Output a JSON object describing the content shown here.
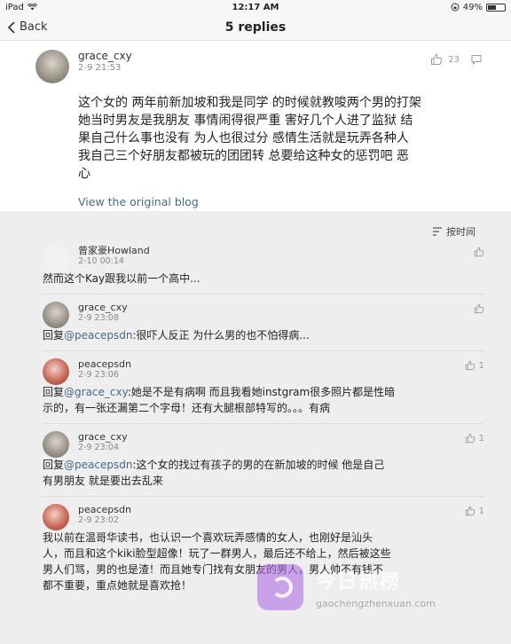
{
  "status": {
    "device": "iPad",
    "time": "12:17 AM",
    "battery": "49%",
    "battery_level": 0.49
  },
  "nav": {
    "back_label": "Back",
    "title": "5 replies"
  },
  "post": {
    "username": "grace_cxy",
    "date": "2-9 21:53",
    "likes": "23",
    "lines": [
      "这个女的 两年前新加坡和我是同学 的时候就教唆两个男的打架",
      "她当时男友是我朋友  事情闹得很严重 害好几个人进了监狱 结",
      "果自己什么事也没有  为人也很过分 感情生活就是玩弄各种人",
      "我自己三个好朋友都被玩的团团转 总要给这种女的惩罚吧  恶",
      "心"
    ],
    "view_original": "View the original blog"
  },
  "sort": {
    "label": "按时间"
  },
  "replies": [
    {
      "name": "曾家豪Howland",
      "date": "2-10 00:14",
      "likes": "",
      "line1_prefix": "然而这个Kay跟我以前一个高中...",
      "line1_mention": "",
      "line1_suffix": "",
      "line2": ""
    },
    {
      "name": "grace_cxy",
      "date": "2-9 23:08",
      "likes": "",
      "line1_prefix": "回复",
      "line1_mention": "@peacepsdn",
      "line1_suffix": ":很吓人反正 为什么男的也不怕得病...",
      "line2": ""
    },
    {
      "name": "peacepsdn",
      "date": "2-9 23:06",
      "likes": "1",
      "line1_prefix": "回复",
      "line1_mention": "@grace_cxy",
      "line1_suffix": ":她是不是有病啊 而且我看她instgram很多照片都是性暗",
      "line2": "示的，有一张还漏第二个字母！还有大腿根部特写的。。。有病"
    },
    {
      "name": "grace_cxy",
      "date": "2-9 23:04",
      "likes": "1",
      "line1_prefix": "回复",
      "line1_mention": "@peacepsdn",
      "line1_suffix": ":这个女的找过有孩子的男的在新加坡的时候 他是自己",
      "line2": "有男朋友 就是要出去乱来"
    },
    {
      "name": "peacepsdn",
      "date": "2-9 23:02",
      "likes": "1",
      "lines": [
        "我以前在温哥华读书，也认识一个喜欢玩弄感情的女人，也刚好是汕头",
        "人，而且和这个kiki脸型超像！玩了一群男人，最后还不给上，然后被这些",
        "男人们骂，男的也是渣！而且她专门找有女朋友的男人，男人帅不有钱不",
        "都不重要，重点她就是喜欢抢！"
      ]
    }
  ],
  "watermark": {
    "title": "今日热榜",
    "url": "gaochengzhenxuan.com"
  }
}
